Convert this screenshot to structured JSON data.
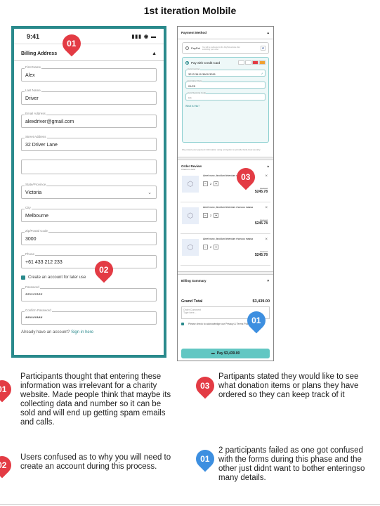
{
  "title": "1st iteration Molbile",
  "phone1": {
    "time": "9:41",
    "status_icons": "▮▮▮ ◉ ▬",
    "section": "Billing Address",
    "collapse": "▲",
    "fields": [
      {
        "label": "First Name",
        "value": "Alex"
      },
      {
        "label": "Last Name",
        "value": "Driver"
      },
      {
        "label": "Email Address",
        "value": "alexdriver@gmail.com"
      },
      {
        "label": "Street Address",
        "value": "32 Driver Lane"
      },
      {
        "label": "",
        "value": ""
      },
      {
        "label": "State/Province",
        "value": "Victoria"
      },
      {
        "label": "City",
        "value": "Melbourne"
      },
      {
        "label": "Zip/Postal Code",
        "value": "3000"
      },
      {
        "label": "Phone",
        "value": "+61 433 212 233"
      }
    ],
    "create_account": "Create an account for later use",
    "password": {
      "label": "Password",
      "value": "*********"
    },
    "confirm_password": {
      "label": "Confirm Password",
      "value": "*********"
    },
    "already": "Already have an account?",
    "signin": "Sign in here"
  },
  "phone2": {
    "payment_header": "Payment Method",
    "paypal": "PayPal",
    "paypal_note": "You will be redirected to the PayPal website after submitting your order",
    "paypal_icon": "P",
    "cc_label": "Pay with Credit Card",
    "card_logos": [
      "VISA",
      "AMEX",
      "MC",
      "MC"
    ],
    "card_number": {
      "label": "Card number",
      "value": "3213 3419 3609 3281"
    },
    "expiry": {
      "label": "Expiration Date",
      "value": "01/25"
    },
    "cvc": {
      "label": "Card Security Code",
      "value": "***"
    },
    "what_is_this": "What is this?",
    "secure_note": "We protect your payment information using encryption to provide bank-level security.",
    "order_header": "Order Review",
    "items_count": "3 items in card",
    "items": [
      {
        "name": "Amet nunc, tincidunt interdum rhoncus massa",
        "qty": "2",
        "old": "$316.78",
        "price": "$245.78"
      },
      {
        "name": "Amet nunc, tincidunt interdum rhoncus massa",
        "qty": "2",
        "old": "$316.78",
        "price": "$245.78"
      },
      {
        "name": "Amet nunc, tincidunt interdum rhoncus massa",
        "qty": "2",
        "old": "$316.78",
        "price": "$245.78"
      }
    ],
    "billing_summary": "Billing Summary",
    "grand_total_label": "Grand Total",
    "grand_total": "$3,439.00",
    "order_comment_label": "Order Comment",
    "order_comment_placeholder": "Type here...",
    "terms": "Please check to acknowledge our Privacy & Terms Policy",
    "pay_button": "Pay $3,439.00"
  },
  "pins": {
    "p1": "01",
    "p2": "02",
    "p3": "03",
    "p4": "01"
  },
  "notes": {
    "n1_num": "01",
    "n1": "Participants thought that entering these information was irrelevant for a charity website. Made people think that maybe its collecting data and number so it can be sold and will end up getting spam emails and calls.",
    "n3_num": "03",
    "n3": "Partipants stated they would like to see what donation items or plans they have ordered so they can keep track of it",
    "n2_num": "02",
    "n2": "Users confused as to why you will need to create an account during this process.",
    "n4_num": "01",
    "n4": "2 participants failed as one got confused with the forms during this phase and the other just didnt want to bother enteringso many details."
  },
  "colors": {
    "teal": "#2a8a8c",
    "red": "#e33b44",
    "blue": "#3d8fe0"
  }
}
